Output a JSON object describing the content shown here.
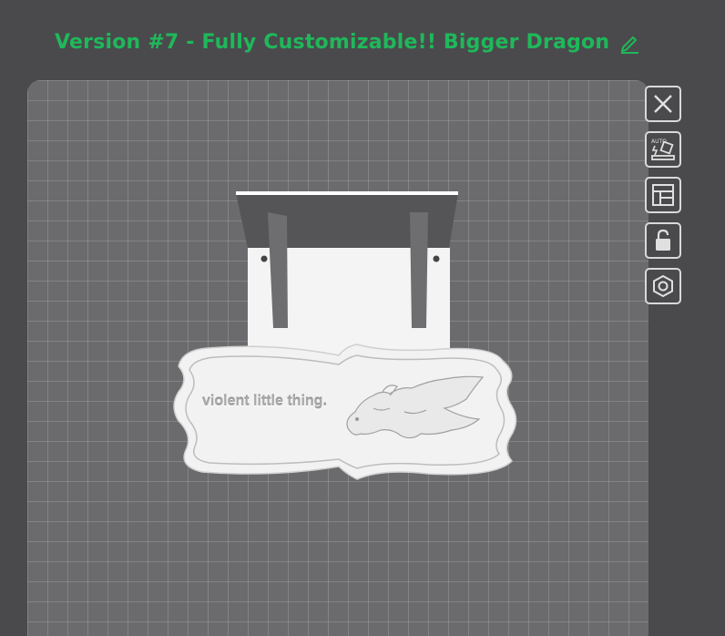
{
  "header": {
    "title": "Version #7 - Fully Customizable!! Bigger Dragon",
    "edit_icon": "pencil-icon",
    "title_color": "#1fb85a"
  },
  "model": {
    "sign_text": "violent little thing."
  },
  "toolbar": {
    "buttons": [
      {
        "icon": "close-icon"
      },
      {
        "icon": "auto-arrange-icon"
      },
      {
        "icon": "layout-icon"
      },
      {
        "icon": "unlock-icon"
      },
      {
        "icon": "hex-nut-icon"
      }
    ]
  }
}
